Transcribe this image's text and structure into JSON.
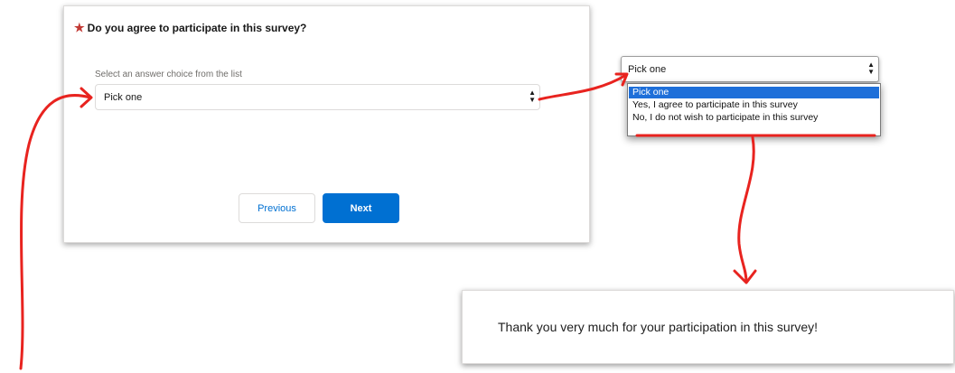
{
  "survey": {
    "required_marker": "★",
    "question": "Do you agree to participate in this survey?",
    "helper": "Select an answer choice from the list",
    "select_value": "Pick one",
    "select_arrows": "▲\n▼",
    "previous_label": "Previous",
    "next_label": "Next"
  },
  "dropdown": {
    "select_value": "Pick one",
    "select_arrows": "▲\n▼",
    "options": [
      "Pick one",
      "Yes, I agree to participate in this survey",
      "No, I do not wish to participate in this survey"
    ],
    "selected_index": 0
  },
  "thanks": {
    "message": "Thank you very much for your participation in this survey!"
  },
  "colors": {
    "annotation": "#e8231f",
    "primary": "#0070d2",
    "required": "#c23934",
    "option_highlight": "#1e6fd9"
  }
}
